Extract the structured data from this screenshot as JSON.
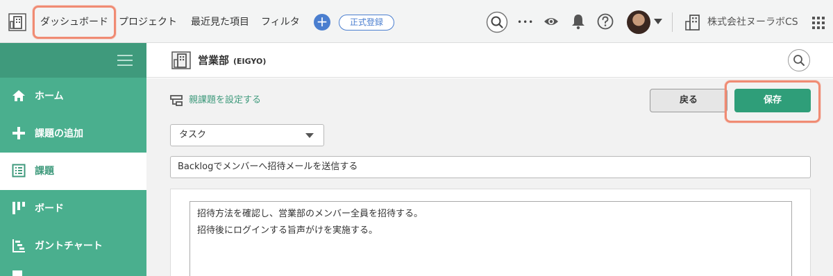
{
  "topbar": {
    "nav": [
      "ダッシュボード",
      "プロジェクト",
      "最近見た項目",
      "フィルタ"
    ],
    "plus_label": "+",
    "register_label": "正式登録",
    "more_label": "•••",
    "org_name": "株式会社ヌーラボCS",
    "icons": [
      "space-icon",
      "add-icon",
      "search-icon",
      "more-icon",
      "watch-icon",
      "bell-icon",
      "help-icon",
      "avatar",
      "building-icon",
      "apps-grid-icon"
    ]
  },
  "sidebar": {
    "items": [
      {
        "label": "ホーム",
        "icon": "home-icon"
      },
      {
        "label": "課題の追加",
        "icon": "plus-icon"
      },
      {
        "label": "課題",
        "icon": "issue-list-icon",
        "active": true
      },
      {
        "label": "ボード",
        "icon": "board-icon"
      },
      {
        "label": "ガントチャート",
        "icon": "gantt-icon"
      }
    ]
  },
  "project": {
    "name": "営業部",
    "key": "(EIGYO)"
  },
  "form": {
    "parent_link": "親課題を設定する",
    "back_label": "戻る",
    "save_label": "保存",
    "issue_type": "タスク",
    "subject": "Backlogでメンバーへ招待メールを送信する",
    "description_lines": [
      "招待方法を確認し、営業部のメンバー全員を招待する。",
      "招待後にログインする旨声がけを実施する。"
    ]
  },
  "colors": {
    "accent_green": "#2f9e79",
    "sidebar_green": "#4aaf8e",
    "highlight": "#f08b73",
    "link_blue": "#4a7ecf"
  }
}
